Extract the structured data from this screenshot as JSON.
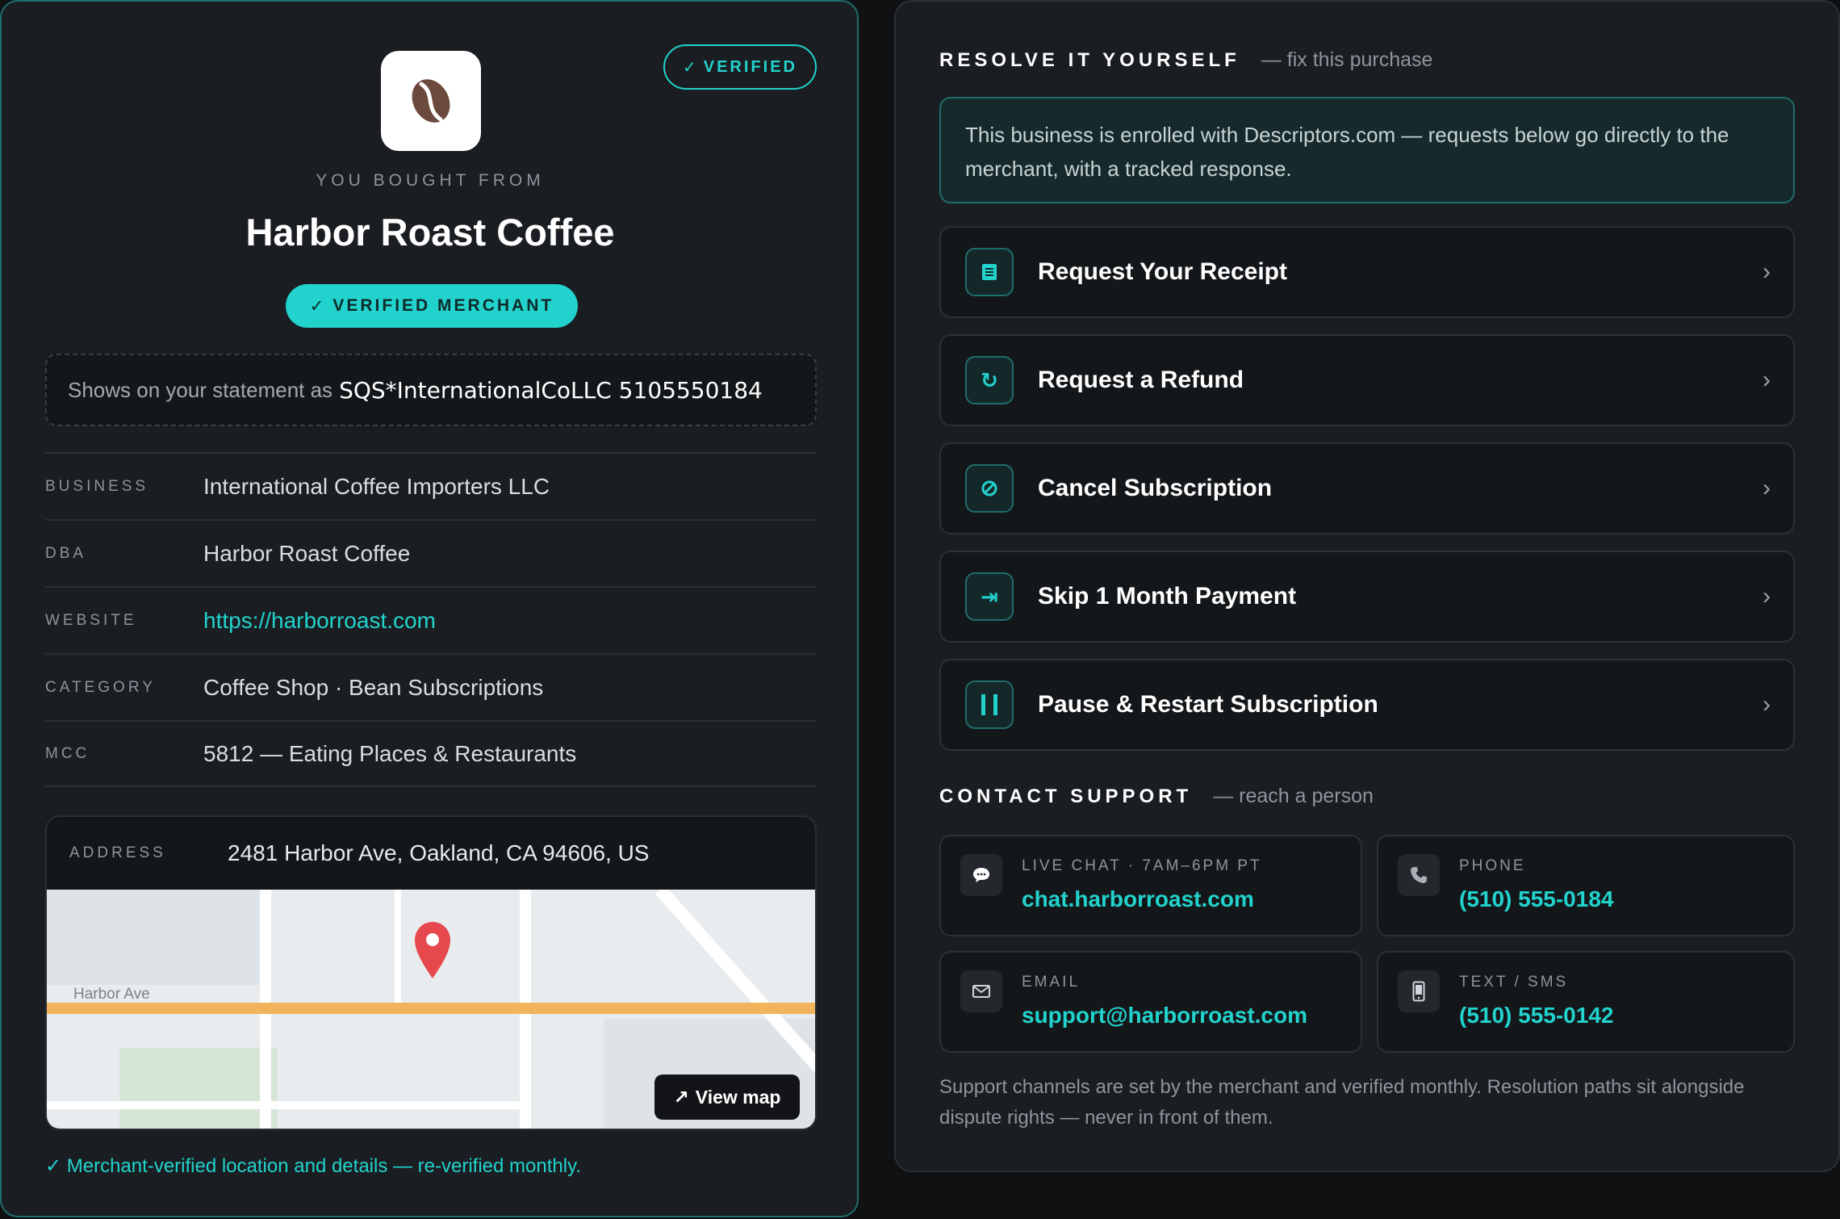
{
  "merchant": {
    "top_badge": "VERIFIED",
    "eyebrow": "YOU BOUGHT FROM",
    "name": "Harbor Roast Coffee",
    "verified_pill": "VERIFIED MERCHANT",
    "statement_prefix": "Shows on your statement as",
    "statement_code": "SQS*InternationalCoLLC 5105550184",
    "details": [
      {
        "label": "BUSINESS",
        "value": "International Coffee Importers LLC"
      },
      {
        "label": "DBA",
        "value": "Harbor Roast Coffee"
      },
      {
        "label": "WEBSITE",
        "value": "https://harborroast.com"
      },
      {
        "label": "CATEGORY",
        "value": "Coffee Shop · Bean Subscriptions"
      },
      {
        "label": "MCC",
        "value": "5812 — Eating Places & Restaurants"
      }
    ],
    "address_label": "ADDRESS",
    "address_value": "2481 Harbor Ave, Oakland, CA 94606, US",
    "map_street": "Harbor Ave",
    "view_map": "View map",
    "footnote": "Merchant-verified location and details — re-verified monthly."
  },
  "resolve": {
    "title": "RESOLVE IT YOURSELF",
    "subtitle": "— fix this purchase",
    "notice": "This business is enrolled with Descriptors.com — requests below go directly to the merchant, with a tracked response.",
    "actions": [
      {
        "label": "Request Your Receipt",
        "icon": "receipt-icon"
      },
      {
        "label": "Request a Refund",
        "icon": "refund-icon"
      },
      {
        "label": "Cancel Subscription",
        "icon": "cancel-icon"
      },
      {
        "label": "Skip 1 Month Payment",
        "icon": "skip-icon"
      },
      {
        "label": "Pause & Restart Subscription",
        "icon": "pause-icon"
      }
    ]
  },
  "support": {
    "title": "CONTACT SUPPORT",
    "subtitle": "— reach a person",
    "channels": [
      {
        "label": "LIVE CHAT · 7AM–6PM PT",
        "value": "chat.harborroast.com",
        "icon": "chat-icon"
      },
      {
        "label": "PHONE",
        "value": "(510) 555-0184",
        "icon": "phone-icon"
      },
      {
        "label": "EMAIL",
        "value": "support@harborroast.com",
        "icon": "email-icon"
      },
      {
        "label": "TEXT / SMS",
        "value": "(510) 555-0142",
        "icon": "mobile-icon"
      }
    ],
    "fine_print": "Support channels are set by the merchant and verified monthly. Resolution paths sit alongside dispute rights — never in front of them."
  },
  "colors": {
    "accent": "#22d3cd",
    "background": "#0f1113",
    "panel": "#1a1d21",
    "pin": "#e5484d"
  }
}
